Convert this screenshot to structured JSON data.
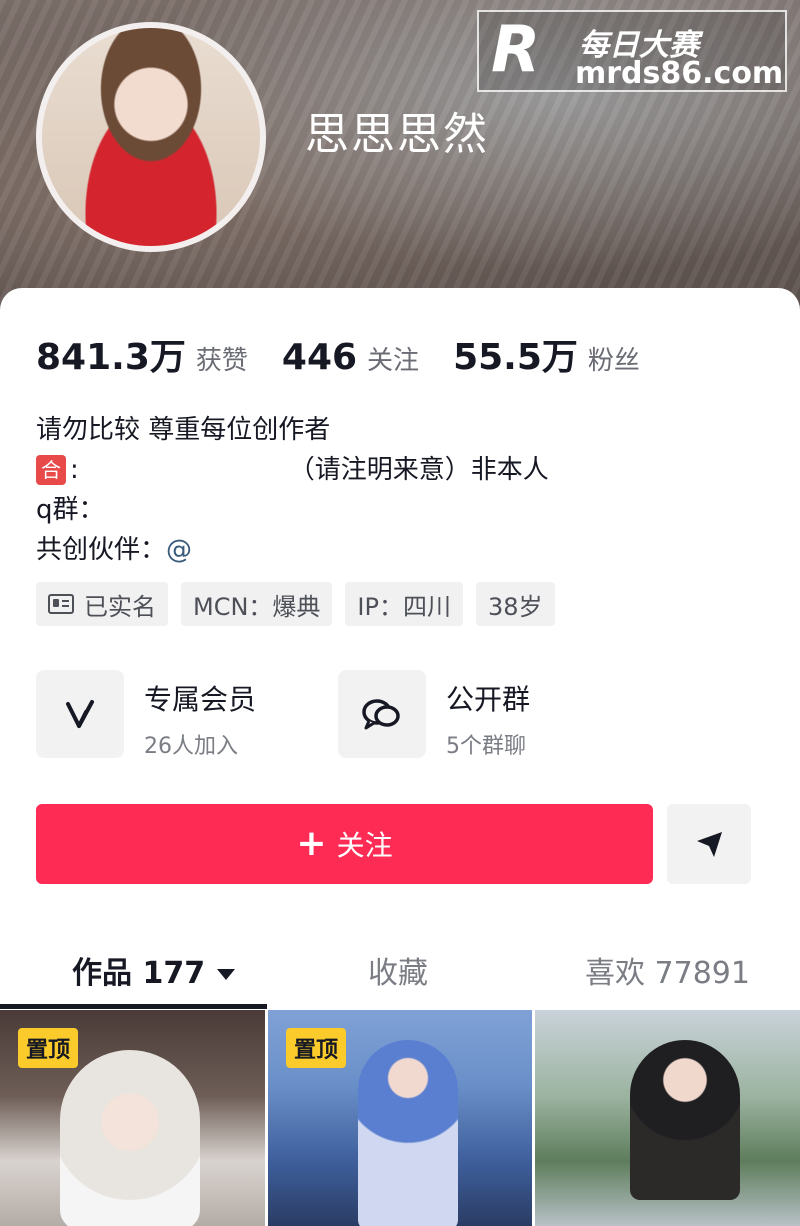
{
  "profile": {
    "nickname": "思思思然"
  },
  "watermark": {
    "logo": "R",
    "title": "每日大赛",
    "url": "mrds86.com"
  },
  "stats": [
    {
      "value": "841.3万",
      "label": "获赞"
    },
    {
      "value": "446",
      "label": "关注"
    },
    {
      "value": "55.5万",
      "label": "粉丝"
    }
  ],
  "bio": {
    "line1": "请勿比较 尊重每位创作者",
    "line2_badge": "合",
    "line2_prefix": ":",
    "line2_suffix": "（请注明来意）非本人",
    "line3": "q群：",
    "line4_prefix": "共创伙伴：",
    "line4_mention": "@"
  },
  "tags": [
    "已实名",
    "MCN：爆典",
    "IP：四川",
    "38岁"
  ],
  "features": [
    {
      "title": "专属会员",
      "sub": "26人加入",
      "icon": "v-icon"
    },
    {
      "title": "公开群",
      "sub": "5个群聊",
      "icon": "chat-icon"
    }
  ],
  "actions": {
    "follow_plus": "+",
    "follow_label": "关注",
    "share_icon": "send-icon"
  },
  "tabs": {
    "works": "作品 177",
    "favorites": "收藏",
    "likes": "喜欢 77891"
  },
  "grid": {
    "pin_label": "置顶"
  },
  "colors": {
    "accent": "#fe2c55",
    "pin": "#facb2a",
    "text": "#161823",
    "muted": "#7b7d85"
  }
}
